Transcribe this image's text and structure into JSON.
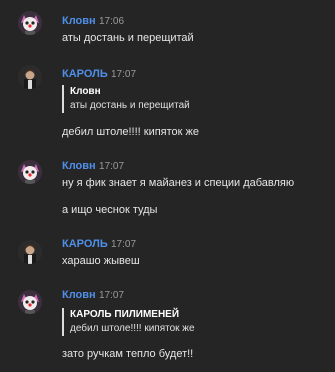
{
  "colors": {
    "background": "#252525",
    "author_name": "#4f8fe8",
    "timestamp": "#9a9a9a",
    "text": "#e6e6e6",
    "quote_bar": "#dcdcdc"
  },
  "messages": [
    {
      "avatar": "clown-avatar-icon",
      "author": "Кловн",
      "time": "17:06",
      "lines": [
        "аты достань и перещитай"
      ]
    },
    {
      "avatar": "karol-avatar-icon",
      "author": "КАРОЛЬ",
      "time": "17:07",
      "quote": {
        "author": "Кловн",
        "text": "аты достань и перещитай"
      },
      "lines": [
        "дебил штоле!!!! кипяток же"
      ]
    },
    {
      "avatar": "clown-avatar-icon",
      "author": "Кловн",
      "time": "17:07",
      "lines": [
        "ну я фик знает я майанез и специи дабавляю",
        "а ищо чеснок туды"
      ]
    },
    {
      "avatar": "karol-avatar-icon",
      "author": "КАРОЛЬ",
      "time": "17:07",
      "lines": [
        "харашо жывеш"
      ]
    },
    {
      "avatar": "clown-avatar-icon",
      "author": "Кловн",
      "time": "17:07",
      "quote": {
        "author": "КАРОЛЬ ПИЛИМЕНЕЙ",
        "text": "дебил штоле!!!! кипяток же"
      },
      "lines": [
        "зато ручкам тепло будет!!"
      ]
    }
  ]
}
